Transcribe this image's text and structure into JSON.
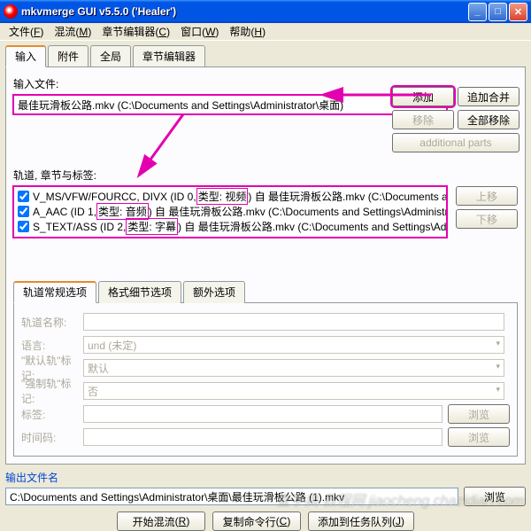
{
  "window": {
    "title": "mkvmerge GUI v5.5.0 ('Healer')"
  },
  "menu": {
    "file": "文件",
    "file_u": "F",
    "mux": "混流",
    "mux_u": "M",
    "chap": "章节编辑器",
    "chap_u": "C",
    "win": "窗口",
    "win_u": "W",
    "help": "帮助",
    "help_u": "H"
  },
  "main_tabs": {
    "input": "输入",
    "attach": "附件",
    "global": "全局",
    "chaped": "章节编辑器"
  },
  "labels": {
    "input_files": "输入文件:",
    "tracks": "轨道, 章节与标签:",
    "output_file": "输出文件名"
  },
  "input_file": "最佳玩滑板公路.mkv (C:\\Documents and Settings\\Administrator\\桌面)",
  "buttons": {
    "add": "添加",
    "append": "追加合并",
    "remove": "移除",
    "remove_all": "全部移除",
    "additional": "additional parts",
    "up": "上移",
    "down": "下移",
    "browse": "浏览",
    "start": "开始混流",
    "start_u": "R",
    "copy_cmd": "复制命令行",
    "copy_u": "C",
    "queue": "添加到任务队列",
    "queue_u": "J"
  },
  "tracks": [
    {
      "pre": "V_MS/VFW/FOURCC, DIVX (ID 0,",
      "type": "类型: 视频",
      "post": ") 自 最佳玩滑板公路.mkv (C:\\Documents and Settings\\Ad"
    },
    {
      "pre": "A_AAC (ID 1,",
      "type": "类型: 音频",
      "post": ") 自 最佳玩滑板公路.mkv (C:\\Documents and Settings\\Administrator\\桌面)"
    },
    {
      "pre": "S_TEXT/ASS (ID 2,",
      "type": "类型: 字幕",
      "post": ") 自 最佳玩滑板公路.mkv (C:\\Documents and Settings\\Administrator\\桌"
    }
  ],
  "sub_tabs": {
    "general": "轨道常规选项",
    "format": "格式细节选项",
    "extra": "额外选项"
  },
  "form": {
    "track_name": "轨道名称:",
    "language": "语言:",
    "language_val": "und (未定)",
    "default_flag": "\"默认轨\"标记:",
    "default_val": "默认",
    "forced_flag": "\"强制轨\"标记:",
    "forced_val": "否",
    "tags": "标签:",
    "timecodes": "时间码:"
  },
  "output_path": "C:\\Documents and Settings\\Administrator\\桌面\\最佳玩滑板公路 (1).mkv",
  "watermark": "查字典 教程网\njiaocheng.chazidian.com"
}
